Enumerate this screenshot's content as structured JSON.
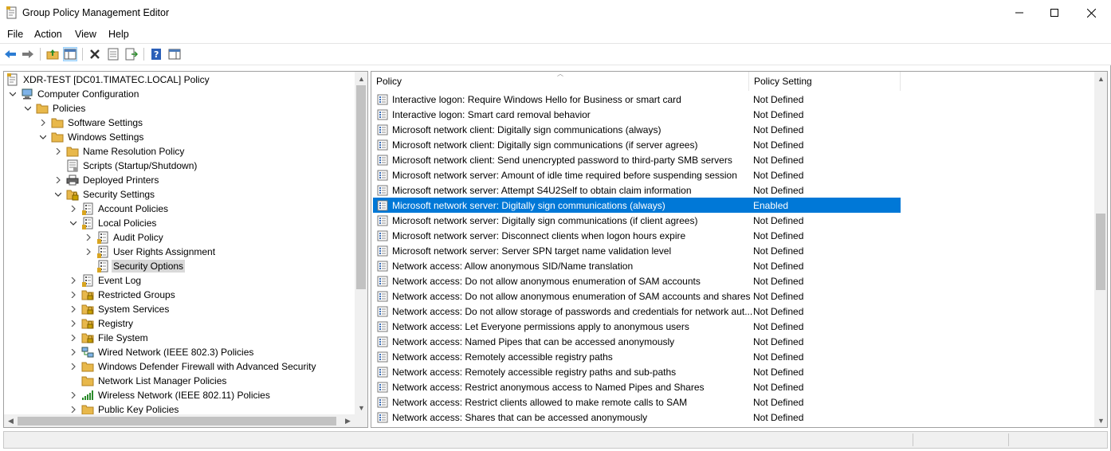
{
  "window": {
    "title": "Group Policy Management Editor"
  },
  "menu": [
    "File",
    "Action",
    "View",
    "Help"
  ],
  "toolbar": [
    "back-icon",
    "forward-icon",
    "up-folder-icon",
    "show-hide-tree-icon",
    "delete-icon",
    "properties-icon",
    "export-list-icon",
    "help-icon",
    "show-hide-action-pane-icon"
  ],
  "tree": [
    {
      "label": "XDR-TEST [DC01.TIMATEC.LOCAL] Policy",
      "icon": "policy-doc-icon",
      "level": 0,
      "expander": "",
      "name": "tree-item-xdr-test-policy"
    },
    {
      "label": "Computer Configuration",
      "icon": "computer-icon",
      "level": 0,
      "expander": "down",
      "name": "tree-item-computer-configuration"
    },
    {
      "label": "Policies",
      "icon": "folder-icon",
      "level": 1,
      "expander": "down",
      "name": "tree-item-policies"
    },
    {
      "label": "Software Settings",
      "icon": "folder-icon",
      "level": 2,
      "expander": "right",
      "name": "tree-item-software-settings"
    },
    {
      "label": "Windows Settings",
      "icon": "folder-icon",
      "level": 2,
      "expander": "down",
      "name": "tree-item-windows-settings"
    },
    {
      "label": "Name Resolution Policy",
      "icon": "folder-icon",
      "level": 3,
      "expander": "right",
      "name": "tree-item-name-resolution-policy"
    },
    {
      "label": "Scripts (Startup/Shutdown)",
      "icon": "script-icon",
      "level": 3,
      "expander": "",
      "name": "tree-item-scripts"
    },
    {
      "label": "Deployed Printers",
      "icon": "printer-icon",
      "level": 3,
      "expander": "right",
      "name": "tree-item-deployed-printers"
    },
    {
      "label": "Security Settings",
      "icon": "security-settings-icon",
      "level": 3,
      "expander": "down",
      "name": "tree-item-security-settings"
    },
    {
      "label": "Account Policies",
      "icon": "policy-list-icon",
      "level": 4,
      "expander": "right",
      "name": "tree-item-account-policies"
    },
    {
      "label": "Local Policies",
      "icon": "policy-list-icon",
      "level": 4,
      "expander": "down",
      "name": "tree-item-local-policies"
    },
    {
      "label": "Audit Policy",
      "icon": "policy-list-icon",
      "level": 5,
      "expander": "right",
      "name": "tree-item-audit-policy"
    },
    {
      "label": "User Rights Assignment",
      "icon": "policy-list-icon",
      "level": 5,
      "expander": "right",
      "name": "tree-item-user-rights-assignment"
    },
    {
      "label": "Security Options",
      "icon": "policy-list-icon",
      "level": 5,
      "expander": "",
      "name": "tree-item-security-options",
      "selected": true
    },
    {
      "label": "Event Log",
      "icon": "policy-list-icon",
      "level": 4,
      "expander": "right",
      "name": "tree-item-event-log"
    },
    {
      "label": "Restricted Groups",
      "icon": "locked-folder-icon",
      "level": 4,
      "expander": "right",
      "name": "tree-item-restricted-groups"
    },
    {
      "label": "System Services",
      "icon": "locked-folder-icon",
      "level": 4,
      "expander": "right",
      "name": "tree-item-system-services"
    },
    {
      "label": "Registry",
      "icon": "locked-folder-icon",
      "level": 4,
      "expander": "right",
      "name": "tree-item-registry"
    },
    {
      "label": "File System",
      "icon": "locked-folder-icon",
      "level": 4,
      "expander": "right",
      "name": "tree-item-file-system"
    },
    {
      "label": "Wired Network (IEEE 802.3) Policies",
      "icon": "network-icon",
      "level": 4,
      "expander": "right",
      "name": "tree-item-wired-network"
    },
    {
      "label": "Windows Defender Firewall with Advanced Security",
      "icon": "folder-icon",
      "level": 4,
      "expander": "right",
      "name": "tree-item-firewall"
    },
    {
      "label": "Network List Manager Policies",
      "icon": "folder-icon",
      "level": 4,
      "expander": "",
      "name": "tree-item-network-list-manager"
    },
    {
      "label": "Wireless Network (IEEE 802.11) Policies",
      "icon": "signal-icon",
      "level": 4,
      "expander": "right",
      "name": "tree-item-wireless-network"
    },
    {
      "label": "Public Key Policies",
      "icon": "folder-icon",
      "level": 4,
      "expander": "right",
      "name": "tree-item-public-key-policies"
    }
  ],
  "list": {
    "headers": {
      "policy": "Policy",
      "setting": "Policy Setting"
    },
    "rows": [
      {
        "policy": "Interactive logon: Require Windows Hello for Business or smart card",
        "setting": "Not Defined"
      },
      {
        "policy": "Interactive logon: Smart card removal behavior",
        "setting": "Not Defined"
      },
      {
        "policy": "Microsoft network client: Digitally sign communications (always)",
        "setting": "Not Defined"
      },
      {
        "policy": "Microsoft network client: Digitally sign communications (if server agrees)",
        "setting": "Not Defined"
      },
      {
        "policy": "Microsoft network client: Send unencrypted password to third-party SMB servers",
        "setting": "Not Defined"
      },
      {
        "policy": "Microsoft network server: Amount of idle time required before suspending session",
        "setting": "Not Defined"
      },
      {
        "policy": "Microsoft network server: Attempt S4U2Self to obtain claim information",
        "setting": "Not Defined"
      },
      {
        "policy": "Microsoft network server: Digitally sign communications (always)",
        "setting": "Enabled",
        "selected": true
      },
      {
        "policy": "Microsoft network server: Digitally sign communications (if client agrees)",
        "setting": "Not Defined"
      },
      {
        "policy": "Microsoft network server: Disconnect clients when logon hours expire",
        "setting": "Not Defined"
      },
      {
        "policy": "Microsoft network server: Server SPN target name validation level",
        "setting": "Not Defined"
      },
      {
        "policy": "Network access: Allow anonymous SID/Name translation",
        "setting": "Not Defined"
      },
      {
        "policy": "Network access: Do not allow anonymous enumeration of SAM accounts",
        "setting": "Not Defined"
      },
      {
        "policy": "Network access: Do not allow anonymous enumeration of SAM accounts and shares",
        "setting": "Not Defined"
      },
      {
        "policy": "Network access: Do not allow storage of passwords and credentials for network aut...",
        "setting": "Not Defined"
      },
      {
        "policy": "Network access: Let Everyone permissions apply to anonymous users",
        "setting": "Not Defined"
      },
      {
        "policy": "Network access: Named Pipes that can be accessed anonymously",
        "setting": "Not Defined"
      },
      {
        "policy": "Network access: Remotely accessible registry paths",
        "setting": "Not Defined"
      },
      {
        "policy": "Network access: Remotely accessible registry paths and sub-paths",
        "setting": "Not Defined"
      },
      {
        "policy": "Network access: Restrict anonymous access to Named Pipes and Shares",
        "setting": "Not Defined"
      },
      {
        "policy": "Network access: Restrict clients allowed to make remote calls to SAM",
        "setting": "Not Defined"
      },
      {
        "policy": "Network access: Shares that can be accessed anonymously",
        "setting": "Not Defined"
      }
    ]
  },
  "colors": {
    "selection": "#0078d7",
    "tree_selection": "#d9d9d9",
    "folder": "#e8b84b"
  }
}
